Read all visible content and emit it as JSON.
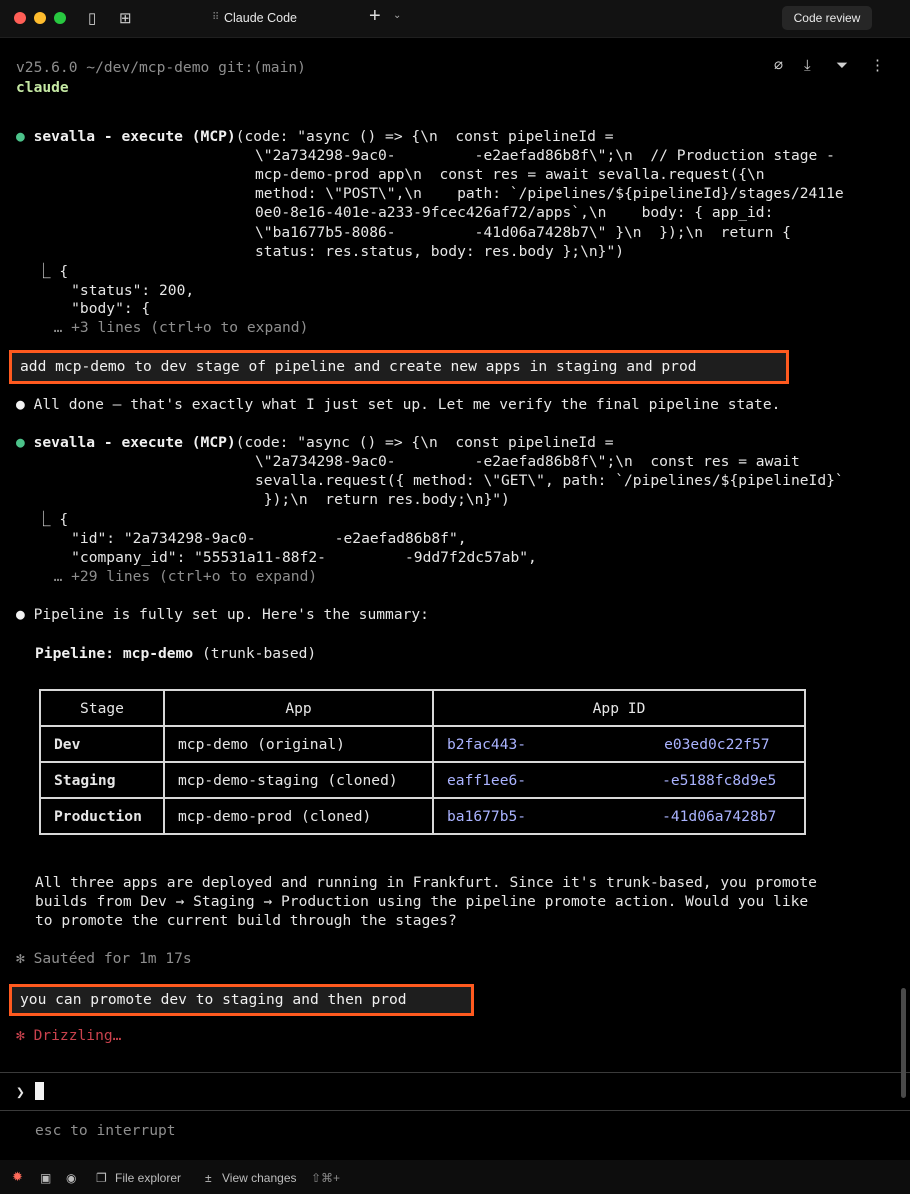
{
  "window": {
    "title": "Claude Code",
    "code_review_label": "Code review"
  },
  "header": {
    "version_line": "v25.6.0 ~/dev/mcp-demo git:(main)",
    "command": "claude"
  },
  "tool_call_1": {
    "name": "sevalla - execute (MCP)",
    "lines": [
      "(code: \"async () => {\\n  const pipelineId =",
      "\\\"2a734298-9ac0-         -e2aefad86b8f\\\";\\n  // Production stage -",
      "mcp-demo-prod app\\n  const res = await sevalla.request({\\n",
      "method: \\\"POST\\\",\\n    path: `/pipelines/${pipelineId}/stages/2411e",
      "0e0-8e16-401e-a233-9fcec426af72/apps`,\\n    body: { app_id:",
      "\\\"ba1677b5-8086-         -41d06a7428b7\\\" }\\n  });\\n  return {",
      "status: res.status, body: res.body };\\n}\")"
    ],
    "result": [
      "⎿ {",
      "    \"status\": 200,",
      "    \"body\": {",
      "  … +3 lines (ctrl+o to expand)"
    ]
  },
  "user_prompt_1": "add mcp-demo to dev stage of pipeline and create new apps in staging and prod",
  "assistant_1": "All done — that's exactly what I just set up. Let me verify the final pipeline state.",
  "tool_call_2": {
    "name": "sevalla - execute (MCP)",
    "lines": [
      "(code: \"async () => {\\n  const pipelineId =",
      "\\\"2a734298-9ac0-         -e2aefad86b8f\\\";\\n  const res = await",
      "sevalla.request({ method: \\\"GET\\\", path: `/pipelines/${pipelineId}`",
      " });\\n  return res.body;\\n}\")"
    ],
    "result": [
      "⎿ {",
      "    \"id\": \"2a734298-9ac0-         -e2aefad86b8f\",",
      "    \"company_id\": \"55531a11-88f2-         -9dd7f2dc57ab\",",
      "  … +29 lines (ctrl+o to expand)"
    ]
  },
  "assistant_2": {
    "intro": "Pipeline is fully set up. Here's the summary:",
    "pipeline_label": "Pipeline:",
    "pipeline_name": "mcp-demo",
    "pipeline_mode": " (trunk-based)",
    "table": {
      "headers": [
        "Stage",
        "App",
        "App ID"
      ],
      "rows": [
        {
          "stage": "Dev",
          "app": "mcp-demo (original)",
          "id_start": "b2fac443-",
          "id_end": "e03ed0c22f57"
        },
        {
          "stage": "Staging",
          "app": "mcp-demo-staging (cloned)",
          "id_start": "eaff1ee6-",
          "id_end": "-e5188fc8d9e5"
        },
        {
          "stage": "Production",
          "app": "mcp-demo-prod (cloned)",
          "id_start": "ba1677b5-",
          "id_end": "-41d06a7428b7"
        }
      ]
    },
    "outro": [
      "All three apps are deployed and running in Frankfurt. Since it's trunk-based, you promote",
      "builds from Dev → Staging → Production using the pipeline promote action. Would you like",
      "to promote the current build through the stages?"
    ]
  },
  "sauteed": "✻ Sautéed for 1m 17s",
  "user_prompt_2": "you can promote dev to staging and then prod",
  "drizzling": "✻ Drizzling…",
  "input": {
    "prompt_symbol": "❯",
    "value": ""
  },
  "hint": "esc to interrupt",
  "statusbar": {
    "file_explorer": "File explorer",
    "view_changes": "View changes",
    "shortcut": "⇧⌘+"
  }
}
